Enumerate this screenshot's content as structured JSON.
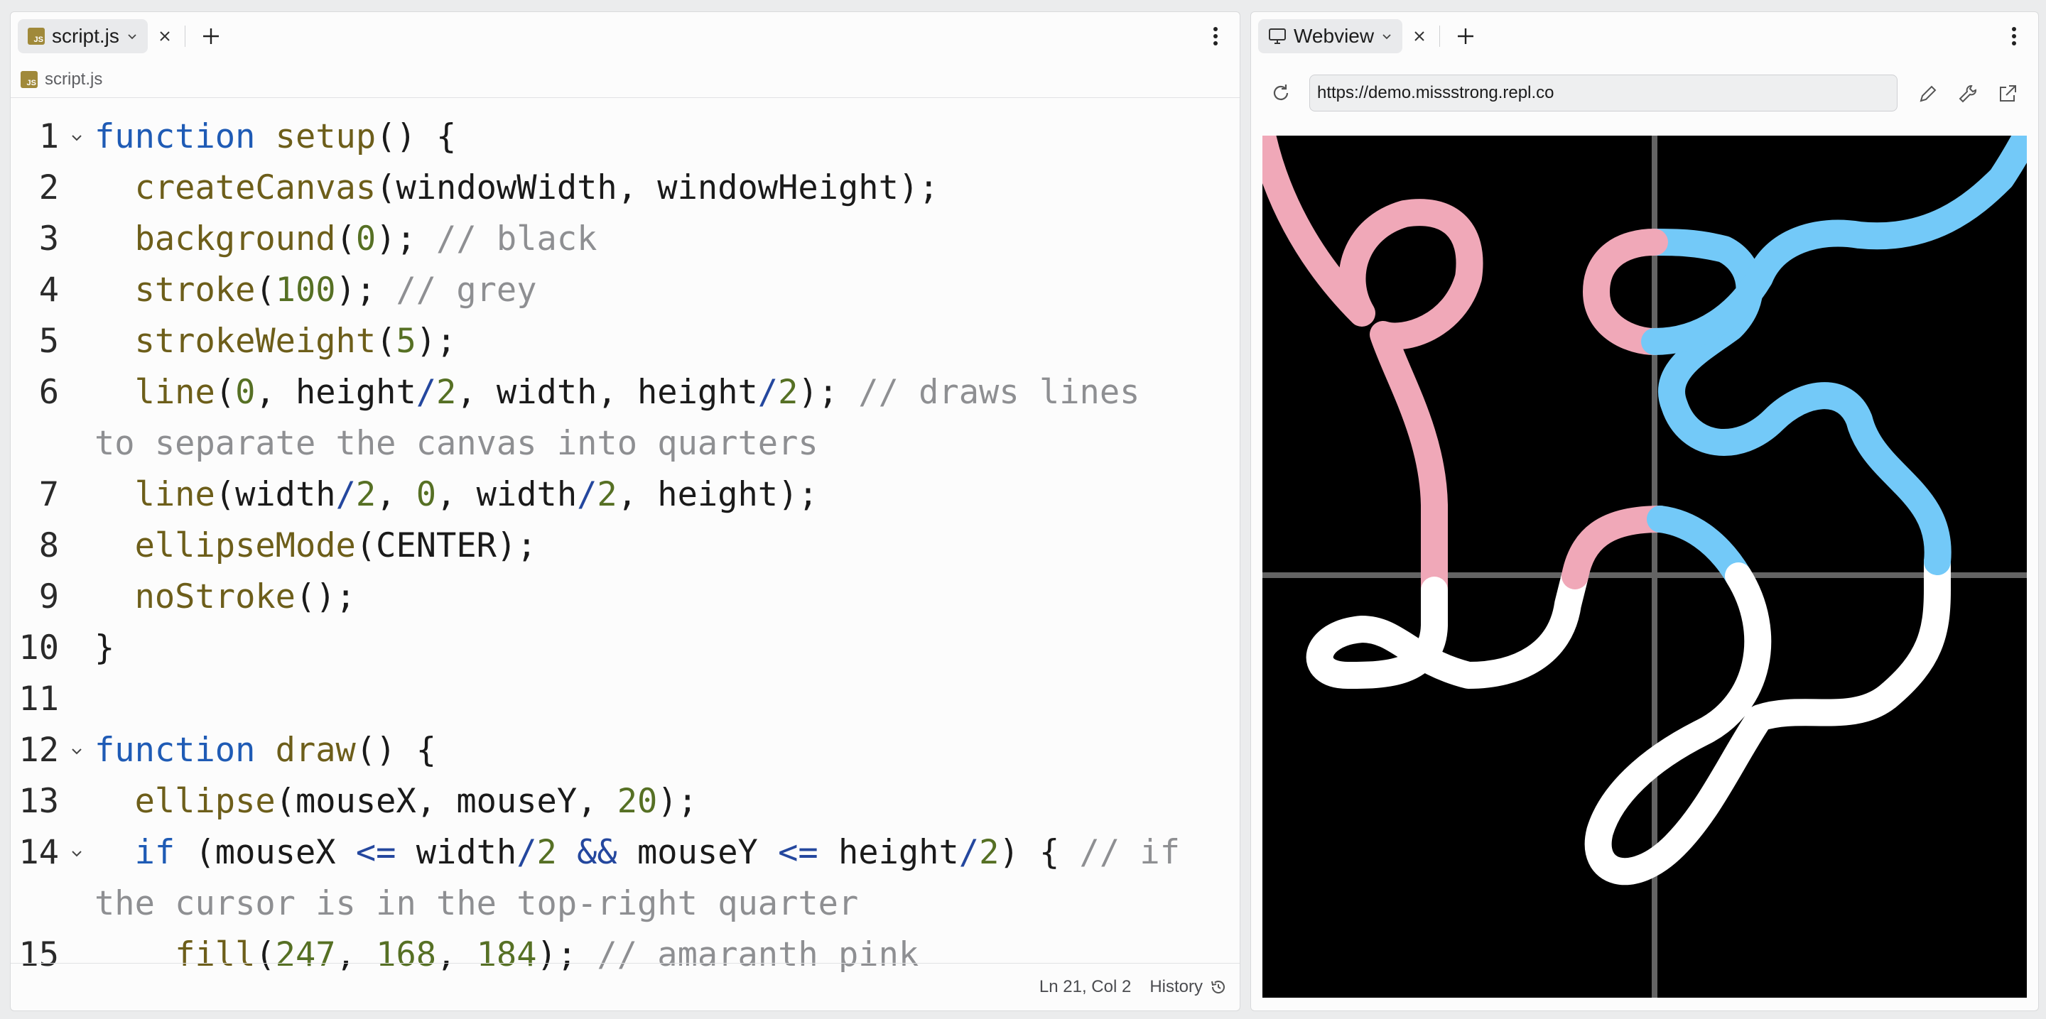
{
  "editor": {
    "tab": {
      "label": "script.js",
      "icon": "js-file-icon"
    },
    "breadcrumb": "script.js",
    "code_lines": [
      {
        "n": "1",
        "fold": true,
        "segs": [
          [
            "kw",
            "function"
          ],
          [
            "",
            " "
          ],
          [
            "fn",
            "setup"
          ],
          [
            "",
            "() {"
          ]
        ]
      },
      {
        "n": "2",
        "segs": [
          [
            "",
            "  "
          ],
          [
            "fn",
            "createCanvas"
          ],
          [
            "",
            "(windowWidth, windowHeight);"
          ]
        ]
      },
      {
        "n": "3",
        "segs": [
          [
            "",
            "  "
          ],
          [
            "fn",
            "background"
          ],
          [
            "",
            "("
          ],
          [
            "num",
            "0"
          ],
          [
            "",
            "); "
          ],
          [
            "cm",
            "// black"
          ]
        ]
      },
      {
        "n": "4",
        "segs": [
          [
            "",
            "  "
          ],
          [
            "fn",
            "stroke"
          ],
          [
            "",
            "("
          ],
          [
            "num",
            "100"
          ],
          [
            "",
            "); "
          ],
          [
            "cm",
            "// grey"
          ]
        ]
      },
      {
        "n": "5",
        "segs": [
          [
            "",
            "  "
          ],
          [
            "fn",
            "strokeWeight"
          ],
          [
            "",
            "("
          ],
          [
            "num",
            "5"
          ],
          [
            "",
            ");"
          ]
        ]
      },
      {
        "n": "6",
        "segs": [
          [
            "",
            "  "
          ],
          [
            "fn",
            "line"
          ],
          [
            "",
            "("
          ],
          [
            "num",
            "0"
          ],
          [
            "",
            ", height"
          ],
          [
            "op",
            "/"
          ],
          [
            "num",
            "2"
          ],
          [
            "",
            ", width, height"
          ],
          [
            "op",
            "/"
          ],
          [
            "num",
            "2"
          ],
          [
            "",
            "); "
          ],
          [
            "cm",
            "// draws lines"
          ]
        ]
      },
      {
        "n": "",
        "segs": [
          [
            "cm",
            "to separate the canvas into quarters"
          ]
        ]
      },
      {
        "n": "7",
        "segs": [
          [
            "",
            "  "
          ],
          [
            "fn",
            "line"
          ],
          [
            "",
            "(width"
          ],
          [
            "op",
            "/"
          ],
          [
            "num",
            "2"
          ],
          [
            "",
            ", "
          ],
          [
            "num",
            "0"
          ],
          [
            "",
            ", width"
          ],
          [
            "op",
            "/"
          ],
          [
            "num",
            "2"
          ],
          [
            "",
            ", height);"
          ]
        ]
      },
      {
        "n": "8",
        "segs": [
          [
            "",
            "  "
          ],
          [
            "fn",
            "ellipseMode"
          ],
          [
            "",
            "(CENTER);"
          ]
        ]
      },
      {
        "n": "9",
        "segs": [
          [
            "",
            "  "
          ],
          [
            "fn",
            "noStroke"
          ],
          [
            "",
            "();"
          ]
        ]
      },
      {
        "n": "10",
        "segs": [
          [
            "",
            "}"
          ]
        ]
      },
      {
        "n": "11",
        "segs": []
      },
      {
        "n": "12",
        "fold": true,
        "segs": [
          [
            "kw",
            "function"
          ],
          [
            "",
            " "
          ],
          [
            "fn",
            "draw"
          ],
          [
            "",
            "() {"
          ]
        ]
      },
      {
        "n": "13",
        "segs": [
          [
            "",
            "  "
          ],
          [
            "fn",
            "ellipse"
          ],
          [
            "",
            "(mouseX, mouseY, "
          ],
          [
            "num",
            "20"
          ],
          [
            "",
            ");"
          ]
        ]
      },
      {
        "n": "14",
        "fold": true,
        "segs": [
          [
            "",
            "  "
          ],
          [
            "kw",
            "if"
          ],
          [
            "",
            " (mouseX "
          ],
          [
            "op",
            "<="
          ],
          [
            "",
            ""
          ],
          [
            "",
            " width"
          ],
          [
            "op",
            "/"
          ],
          [
            "num",
            "2"
          ],
          [
            "",
            ""
          ],
          [
            "",
            " "
          ],
          [
            "op",
            "&&"
          ],
          [
            "",
            " mouseY "
          ],
          [
            "op",
            "<="
          ],
          [
            "",
            " height"
          ],
          [
            "op",
            "/"
          ],
          [
            "num",
            "2"
          ],
          [
            "",
            ") { "
          ],
          [
            "cm",
            "// if"
          ]
        ]
      },
      {
        "n": "",
        "segs": [
          [
            "cm",
            "the cursor is in the top-right quarter"
          ]
        ]
      },
      {
        "n": "15",
        "segs": [
          [
            "",
            "    "
          ],
          [
            "fn",
            "fill"
          ],
          [
            "",
            "("
          ],
          [
            "num",
            "247"
          ],
          [
            "",
            ", "
          ],
          [
            "num",
            "168"
          ],
          [
            "",
            ", "
          ],
          [
            "num",
            "184"
          ],
          [
            "",
            "); "
          ],
          [
            "cm",
            "// amaranth pink"
          ]
        ]
      }
    ],
    "status": {
      "position": "Ln 21, Col 2",
      "history": "History"
    }
  },
  "webview": {
    "tab": {
      "label": "Webview",
      "icon": "monitor-icon"
    },
    "url": "https://demo.missstrong.repl.co",
    "canvas": {
      "background": "#000000",
      "grid_color": "#646464",
      "colors": {
        "pink": "#f0a8b8",
        "blue": "#73c9f8",
        "white": "#ffffff"
      }
    }
  }
}
